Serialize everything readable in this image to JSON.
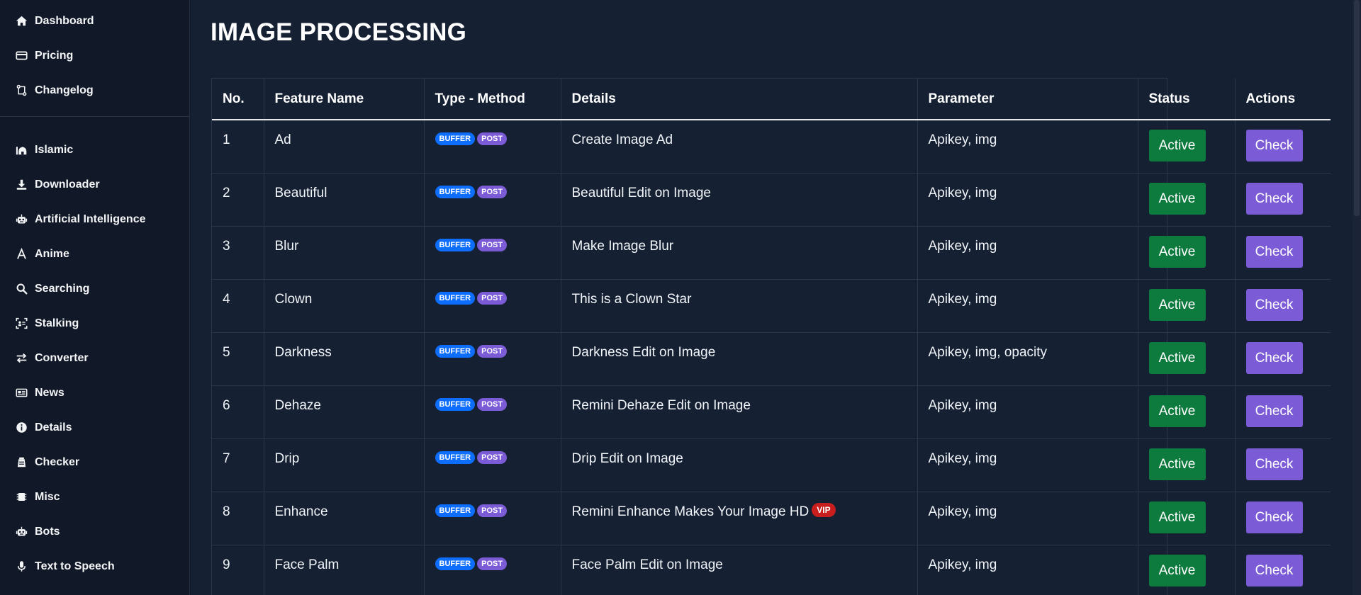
{
  "sidebar": {
    "top_items": [
      {
        "label": "Dashboard",
        "icon": "home-icon"
      },
      {
        "label": "Pricing",
        "icon": "credit-card-icon"
      },
      {
        "label": "Changelog",
        "icon": "changelog-icon"
      }
    ],
    "items": [
      {
        "label": "Islamic",
        "icon": "mosque-icon"
      },
      {
        "label": "Downloader",
        "icon": "download-icon"
      },
      {
        "label": "Artificial Intelligence",
        "icon": "robot-icon"
      },
      {
        "label": "Anime",
        "icon": "anime-icon"
      },
      {
        "label": "Searching",
        "icon": "search-icon"
      },
      {
        "label": "Stalking",
        "icon": "scan-icon"
      },
      {
        "label": "Converter",
        "icon": "exchange-icon"
      },
      {
        "label": "News",
        "icon": "newspaper-icon"
      },
      {
        "label": "Details",
        "icon": "info-icon"
      },
      {
        "label": "Checker",
        "icon": "checker-icon"
      },
      {
        "label": "Misc",
        "icon": "chip-icon"
      },
      {
        "label": "Bots",
        "icon": "robot-icon"
      },
      {
        "label": "Text to Speech",
        "icon": "microphone-icon"
      }
    ]
  },
  "page": {
    "title": "IMAGE PROCESSING"
  },
  "table": {
    "headers": [
      "No.",
      "Feature Name",
      "Type - Method",
      "Details",
      "Parameter",
      "Status",
      "Actions"
    ],
    "rows": [
      {
        "no": "1",
        "name": "Ad",
        "type": "BUFFER",
        "method": "POST",
        "details": "Create Image Ad",
        "vip": "",
        "parameter": "Apikey, img",
        "status": "Active",
        "action": "Check"
      },
      {
        "no": "2",
        "name": "Beautiful",
        "type": "BUFFER",
        "method": "POST",
        "details": "Beautiful Edit on Image",
        "vip": "",
        "parameter": "Apikey, img",
        "status": "Active",
        "action": "Check"
      },
      {
        "no": "3",
        "name": "Blur",
        "type": "BUFFER",
        "method": "POST",
        "details": "Make Image Blur",
        "vip": "",
        "parameter": "Apikey, img",
        "status": "Active",
        "action": "Check"
      },
      {
        "no": "4",
        "name": "Clown",
        "type": "BUFFER",
        "method": "POST",
        "details": "This is a Clown Star",
        "vip": "",
        "parameter": "Apikey, img",
        "status": "Active",
        "action": "Check"
      },
      {
        "no": "5",
        "name": "Darkness",
        "type": "BUFFER",
        "method": "POST",
        "details": "Darkness Edit on Image",
        "vip": "",
        "parameter": "Apikey, img, opacity",
        "status": "Active",
        "action": "Check"
      },
      {
        "no": "6",
        "name": "Dehaze",
        "type": "BUFFER",
        "method": "POST",
        "details": "Remini Dehaze Edit on Image",
        "vip": "",
        "parameter": "Apikey, img",
        "status": "Active",
        "action": "Check"
      },
      {
        "no": "7",
        "name": "Drip",
        "type": "BUFFER",
        "method": "POST",
        "details": "Drip Edit on Image",
        "vip": "",
        "parameter": "Apikey, img",
        "status": "Active",
        "action": "Check"
      },
      {
        "no": "8",
        "name": "Enhance",
        "type": "BUFFER",
        "method": "POST",
        "details": "Remini Enhance Makes Your Image HD",
        "vip": "VIP",
        "parameter": "Apikey, img",
        "status": "Active",
        "action": "Check"
      },
      {
        "no": "9",
        "name": "Face Palm",
        "type": "BUFFER",
        "method": "POST",
        "details": "Face Palm Edit on Image",
        "vip": "",
        "parameter": "Apikey, img",
        "status": "Active",
        "action": "Check"
      }
    ]
  },
  "colors": {
    "background": "#152033",
    "sidebar": "#111827",
    "active_green": "#0d7a3e",
    "check_purple": "#7b5cd6",
    "buffer_blue": "#0d6efd",
    "vip_red": "#c81e1e"
  }
}
